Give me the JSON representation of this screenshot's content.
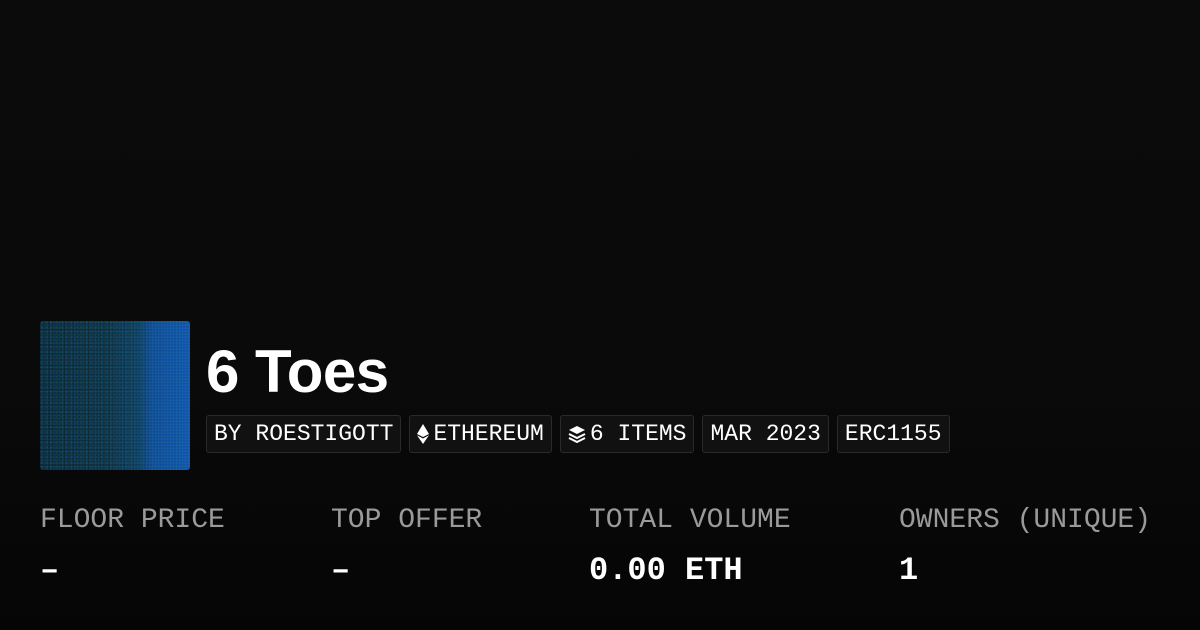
{
  "collection": {
    "name": "6 Toes",
    "thumbnail_icon": "collection-artwork-image"
  },
  "tags": {
    "creator": "BY ROESTIGOTT",
    "chain": "ETHEREUM",
    "chain_icon": "ethereum-icon",
    "items": "6 ITEMS",
    "items_icon": "layers-icon",
    "date": "MAR 2023",
    "standard": "ERC1155"
  },
  "stats": {
    "floor_price": {
      "label": "FLOOR PRICE",
      "value": "–"
    },
    "top_offer": {
      "label": "TOP OFFER",
      "value": "–"
    },
    "total_volume": {
      "label": "TOTAL VOLUME",
      "value": "0.00 ETH"
    },
    "owners": {
      "label": "OWNERS (UNIQUE)",
      "value": "1"
    }
  },
  "colors": {
    "background": "#0a0a0a",
    "text_primary": "#ffffff",
    "text_muted": "#9a9a9a",
    "tag_border": "#2a2a2a",
    "tag_background": "#111111"
  }
}
